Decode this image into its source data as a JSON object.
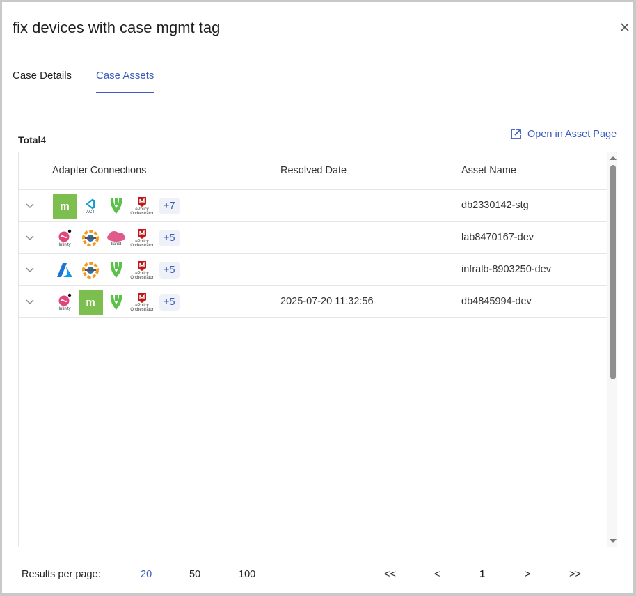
{
  "modal": {
    "title": "fix devices with case mgmt tag"
  },
  "tabs": [
    {
      "label": "Case Details"
    },
    {
      "label": "Case Assets"
    }
  ],
  "summary": {
    "total_label": "Total",
    "total_value": "4",
    "open_link": "Open in Asset Page"
  },
  "table": {
    "headers": [
      "Adapter Connections",
      "Resolved Date",
      "Asset Name"
    ],
    "rows": [
      {
        "logos": [
          "mimecast-icon",
          "act-icon",
          "cylance-icon",
          "epolicy-orchestrator-icon"
        ],
        "more": "+7",
        "resolved_date": "",
        "asset_name": "db2330142-stg"
      },
      {
        "logos": [
          "infinity-icon",
          "orange-gear-icon",
          "ilanet-cloud-icon",
          "epolicy-orchestrator-icon"
        ],
        "more": "+5",
        "resolved_date": "",
        "asset_name": "lab8470167-dev"
      },
      {
        "logos": [
          "azure-icon",
          "orange-gear-icon",
          "cylance-icon",
          "epolicy-orchestrator-icon"
        ],
        "more": "+5",
        "resolved_date": "",
        "asset_name": "infralb-8903250-dev"
      },
      {
        "logos": [
          "infinity-icon",
          "mimecast-icon",
          "cylance-icon",
          "epolicy-orchestrator-icon"
        ],
        "more": "+5",
        "resolved_date": "2025-07-20 11:32:56",
        "asset_name": "db4845994-dev"
      }
    ],
    "logo_text": {
      "act": "ACT",
      "infinity": "Infinity",
      "epo_1": "ePolicy",
      "epo_2": "Orchestrator",
      "ilanet": "Ilanet"
    }
  },
  "pagination": {
    "results_label": "Results per page:",
    "sizes": [
      "20",
      "50",
      "100"
    ],
    "selected_size": "20",
    "nav": [
      "<<",
      "<",
      "1",
      ">",
      ">>"
    ]
  },
  "colors": {
    "accent": "#3b5bbd",
    "mimecast_green": "#7cbf4f",
    "cylance_green": "#5cc14b",
    "mcafee_red": "#c01818"
  }
}
